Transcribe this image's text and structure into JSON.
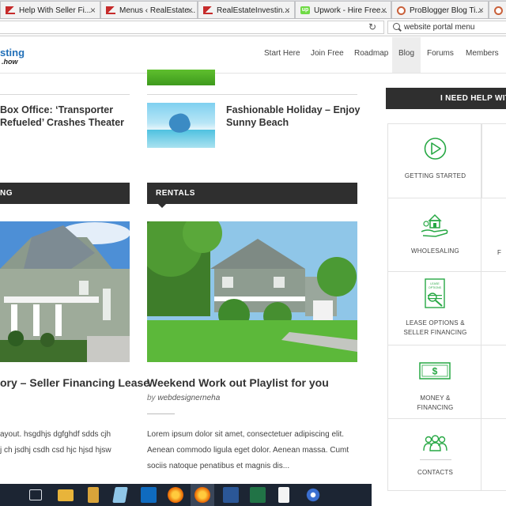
{
  "browser": {
    "tabs": [
      {
        "title": "Help With Seller Fi...",
        "favicon": "red-house-icon"
      },
      {
        "title": "Menus ‹ RealEstate...",
        "favicon": "red-house-icon"
      },
      {
        "title": "RealEstateInvestin...",
        "favicon": "red-house-icon"
      },
      {
        "title": "Upwork - Hire Free...",
        "favicon": "upwork-icon"
      },
      {
        "title": "ProBlogger Blog Ti...",
        "favicon": "problogger-icon"
      },
      {
        "title": "Pr",
        "favicon": "problogger-icon"
      }
    ],
    "close_glyph": "×",
    "reload_glyph": "↻",
    "search_value": "website portal menu",
    "favicon_up_text": "up"
  },
  "site": {
    "logo_top": "sting",
    "logo_sub": ".how",
    "menu": [
      "Start Here",
      "Join Free",
      "Roadmap",
      "Blog",
      "Forums",
      "Members"
    ],
    "active_menu": "Blog"
  },
  "posts": {
    "left_title": "Box Office: ‘Transporter Refueled’ Crashes Theater",
    "left_title_line1": "Box Office: ‘Transporter",
    "left_title_line2": "Refueled’ Crashes Theater",
    "right_title_line1": "Fashionable Holiday – Enjoy",
    "right_title_line2": "Sunny Beach",
    "left_category": "NG",
    "right_category": "RENTALS",
    "left_big_title": "ory – Seller Financing Lease",
    "right_big_title": "Weekend Work out Playlist for you",
    "byline_prefix": "by",
    "byline_author": "webdesignerneha",
    "left_excerpt_line1": "ayout.  hsgdhjs dgfghdf sdds cjh",
    "left_excerpt_line2": "j ch jsdhj csdh csd hjc hjsd hjsw",
    "right_excerpt_line1": "Lorem ipsum dolor sit amet, consectetuer adipiscing elit.",
    "right_excerpt_line2": "Aenean commodo ligula eget dolor. Aenean massa. Cumt",
    "right_excerpt_line3": "sociis natoque penatibus et magnis dis..."
  },
  "sidebar": {
    "heading": "I NEED HELP WIT",
    "items": [
      {
        "label": "GETTING STARTED",
        "icon": "play-circle-icon"
      },
      {
        "label": "WHOLESALING",
        "icon": "house-hand-icon"
      },
      {
        "label_line1": "LEASE OPTIONS &",
        "label_line2": "SELLER FINANCING",
        "icon": "lease-document-icon",
        "doc_text": "LEASE OPTIONS"
      },
      {
        "label_line1": "MONEY &",
        "label_line2": "FINANCING",
        "icon": "dollar-bill-icon"
      },
      {
        "label": "CONTACTS",
        "icon": "people-group-icon"
      }
    ],
    "partial_right_label": "F",
    "accent_color": "#27a844"
  },
  "taskbar": {
    "icons": [
      "task-view-icon",
      "file-explorer-icon",
      "file-manager-icon",
      "notepad-icon",
      "outlook-icon",
      "firefox-icon",
      "firefox-active-icon",
      "word-icon",
      "excel-icon",
      "document-icon",
      "app-icon"
    ]
  }
}
